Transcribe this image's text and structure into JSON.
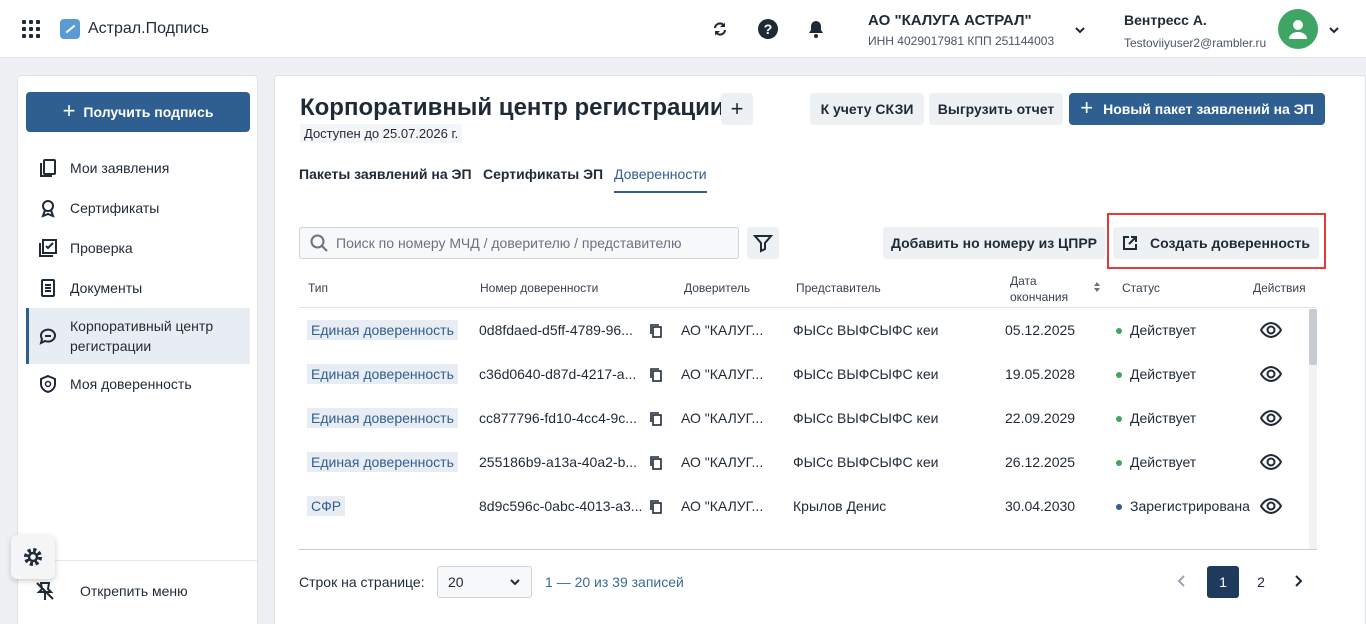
{
  "header": {
    "app_title": "Астрал.Подпись",
    "org_name": "АО \"КАЛУГА АСТРАЛ\"",
    "org_details": "ИНН 4029017981   КПП 251144003",
    "user_name": "Вентресс А.",
    "user_email": "Testoviiyuser2@rambler.ru",
    "icons": [
      "apps-grid-icon",
      "refresh-icon",
      "help-icon",
      "bell-icon",
      "chevron-down-icon",
      "user-avatar-icon"
    ]
  },
  "sidebar": {
    "get_signature_label": "Получить подпись",
    "items": [
      {
        "label": "Мои заявления",
        "icon": "documents-icon"
      },
      {
        "label": "Сертификаты",
        "icon": "certificate-icon"
      },
      {
        "label": "Проверка",
        "icon": "check-icon"
      },
      {
        "label": "Документы",
        "icon": "document-icon"
      },
      {
        "label": "Корпоративный центр регистрации",
        "icon": "chat-icon",
        "active": true
      },
      {
        "label": "Моя доверенность",
        "icon": "shield-icon"
      }
    ],
    "unpin_label": "Открепить меню"
  },
  "main": {
    "title": "Корпоративный центр регистрации",
    "available_until": "Доступен до 25.07.2026 г.",
    "skzi_button": "К учету СКЗИ",
    "export_button": "Выгрузить отчет",
    "new_package_button": "Новый пакет заявлений на ЭП",
    "tabs": [
      {
        "label": "Пакеты заявлений на ЭП"
      },
      {
        "label": "Сертификаты ЭП"
      },
      {
        "label": "Доверенности",
        "active": true
      }
    ],
    "search_placeholder": "Поиск по номеру МЧД / доверителю / представителю",
    "add_by_number_button": "Добавить но номеру из ЦПРР",
    "create_button": "Создать доверенность"
  },
  "table": {
    "columns": {
      "type": "Тип",
      "number": "Номер доверенности",
      "principal": "Доверитель",
      "representative": "Представитель",
      "end_date": "Дата окончания",
      "status": "Статус",
      "actions": "Действия"
    },
    "rows": [
      {
        "type": "Единая доверенность",
        "number": "0d8fdaed-d5ff-4789-96...",
        "principal": "АО \"КАЛУГ...",
        "representative": "ФЫСс ВЫФСЫФС кеи",
        "end_date": "05.12.2025",
        "status": "Действует",
        "status_color": "#3fa564"
      },
      {
        "type": "Единая доверенность",
        "number": "c36d0640-d87d-4217-a...",
        "principal": "АО \"КАЛУГ...",
        "representative": "ФЫСс ВЫФСЫФС кеи",
        "end_date": "19.05.2028",
        "status": "Действует",
        "status_color": "#3fa564"
      },
      {
        "type": "Единая доверенность",
        "number": "cc877796-fd10-4cc4-9c...",
        "principal": "АО \"КАЛУГ...",
        "representative": "ФЫСс ВЫФСЫФС кеи",
        "end_date": "22.09.2029",
        "status": "Действует",
        "status_color": "#3fa564"
      },
      {
        "type": "Единая доверенность",
        "number": "255186b9-a13a-40a2-b...",
        "principal": "АО \"КАЛУГ...",
        "representative": "ФЫСс ВЫФСЫФС кеи",
        "end_date": "26.12.2025",
        "status": "Действует",
        "status_color": "#3fa564"
      },
      {
        "type": "СФР",
        "number": "8d9c596c-0abc-4013-a3...",
        "principal": "АО \"КАЛУГ...",
        "representative": "Крылов Денис",
        "end_date": "30.04.2030",
        "status": "Зарегистрирована",
        "status_color": "#2f5f91"
      }
    ]
  },
  "pagination": {
    "rows_per_page_label": "Строк на странице:",
    "rows_per_page_value": "20",
    "range_text": "1 — 20 из 39 записей",
    "pages": [
      "1",
      "2"
    ],
    "current_page": "1"
  }
}
